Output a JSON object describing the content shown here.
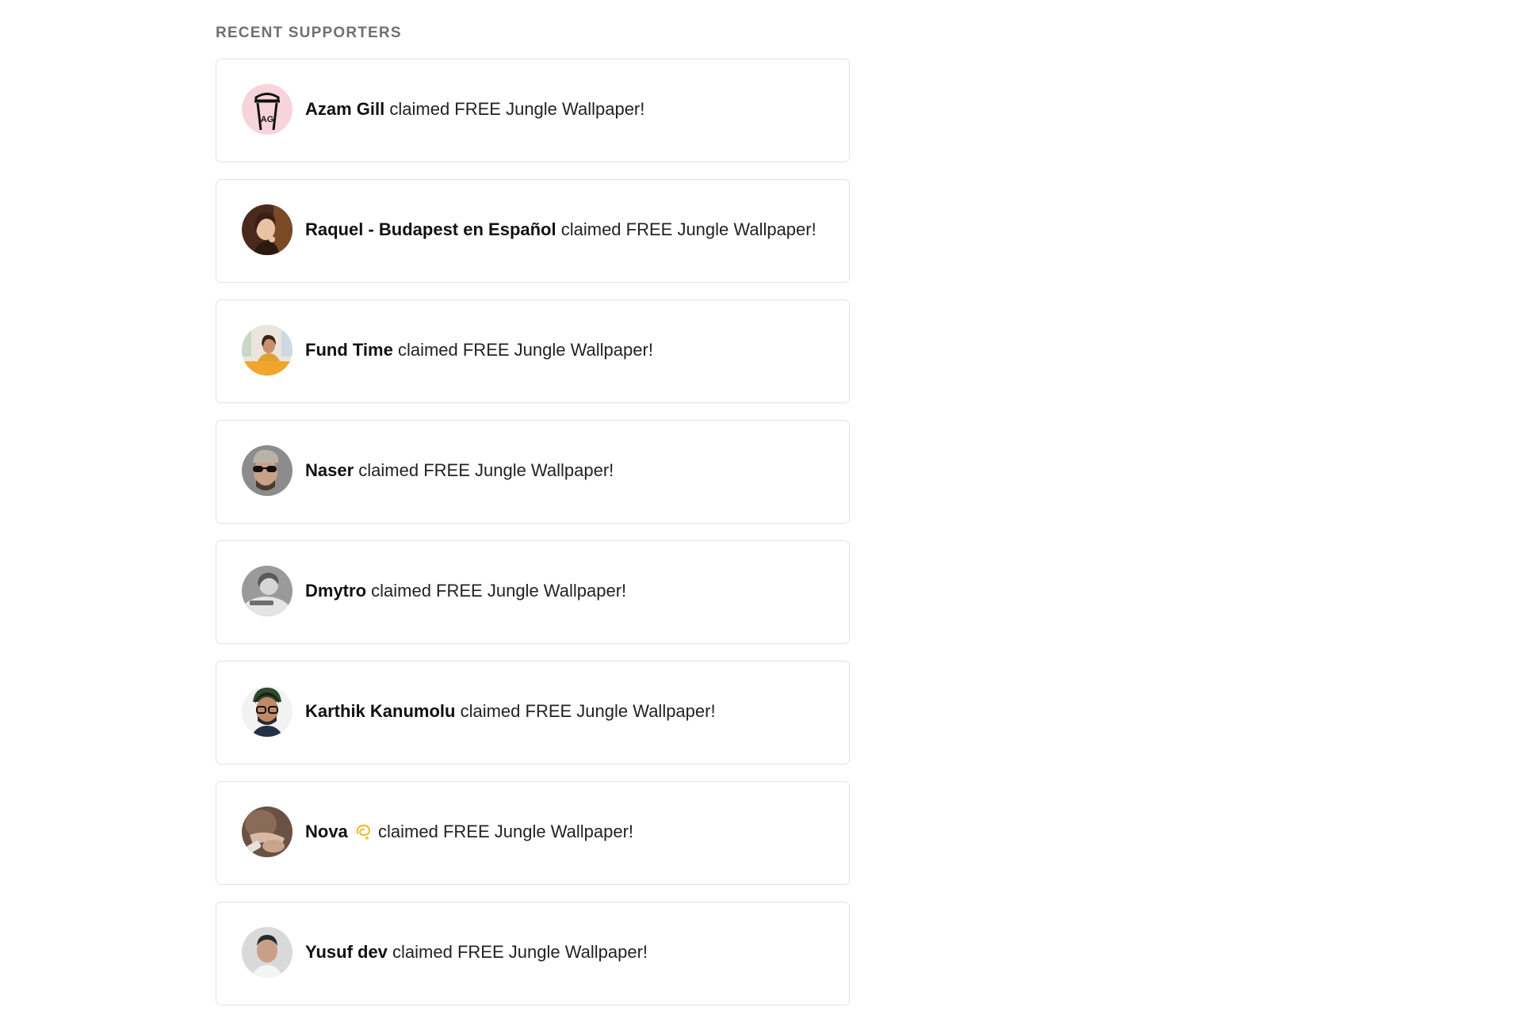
{
  "recent_supporters": {
    "heading": "RECENT SUPPORTERS",
    "items": [
      {
        "name": "Azam Gill",
        "action": "claimed FREE Jungle Wallpaper!",
        "avatar": "coffee-cup-logo-avatar"
      },
      {
        "name": "Raquel - Budapest en Español",
        "action": "claimed FREE Jungle Wallpaper!",
        "avatar": "photo-avatar"
      },
      {
        "name": "Fund Time",
        "action": "claimed FREE Jungle Wallpaper!",
        "avatar": "photo-avatar"
      },
      {
        "name": "Naser",
        "action": "claimed FREE Jungle Wallpaper!",
        "avatar": "photo-avatar"
      },
      {
        "name": "Dmytro",
        "action": "claimed FREE Jungle Wallpaper!",
        "avatar": "photo-avatar"
      },
      {
        "name": "Karthik Kanumolu",
        "action": "claimed FREE Jungle Wallpaper!",
        "avatar": "photo-avatar"
      },
      {
        "name": "Nova",
        "name_emoji": "dizzy-emoji",
        "action": "claimed FREE Jungle Wallpaper!",
        "avatar": "photo-avatar"
      },
      {
        "name": "Yusuf dev",
        "action": "claimed FREE Jungle Wallpaper!",
        "avatar": "photo-avatar"
      }
    ]
  },
  "colors": {
    "heading": "#707070",
    "card_border": "#e2e2e2",
    "text": "#222222",
    "avatar_pink": "#f7d3db"
  }
}
